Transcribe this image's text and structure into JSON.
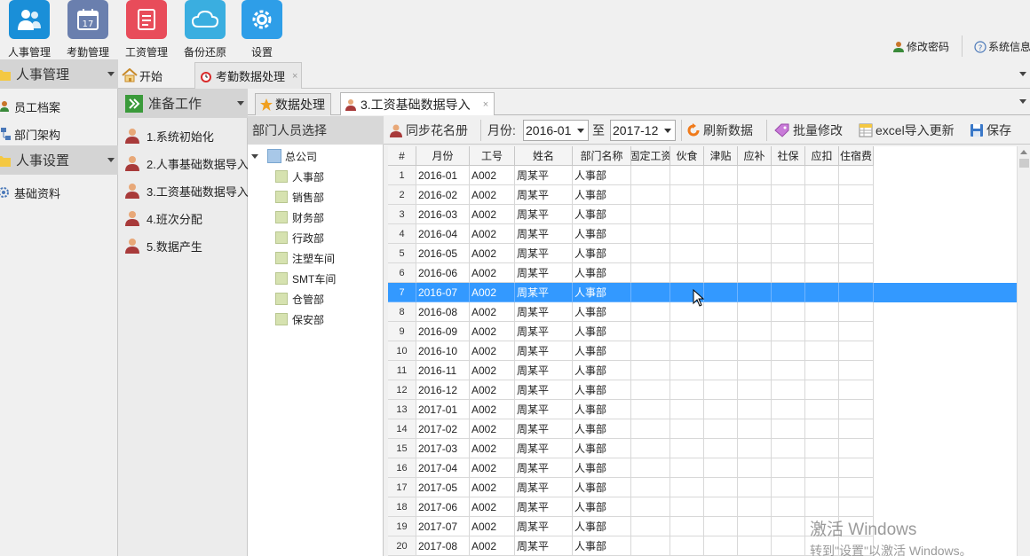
{
  "topbar": {
    "buttons": [
      {
        "label": "人事管理",
        "icon": "people-icon",
        "color": "#1a8fd8"
      },
      {
        "label": "考勤管理",
        "icon": "calendar-icon",
        "color": "#6a7fae"
      },
      {
        "label": "工资管理",
        "icon": "document-icon",
        "color": "#e84c5a"
      },
      {
        "label": "备份还原",
        "icon": "cloud-icon",
        "color": "#3aaee0"
      },
      {
        "label": "设置",
        "icon": "gear-icon",
        "color": "#2e9ee8"
      }
    ],
    "change_password": "修改密码",
    "system_info": "系统信息"
  },
  "leftnav": {
    "section1": "人事管理",
    "items1": [
      "员工档案",
      "部门架构"
    ],
    "section2": "人事设置",
    "items2": [
      "基础资料"
    ]
  },
  "tabs": [
    {
      "label": "开始"
    },
    {
      "label": "考勤数据处理",
      "close": "×"
    }
  ],
  "prep": {
    "title": "准备工作",
    "items": [
      "1.系统初始化",
      "2.人事基础数据导入",
      "3.工资基础数据导入",
      "4.班次分配",
      "5.数据产生"
    ]
  },
  "subtabs": [
    {
      "label": "数据处理"
    },
    {
      "label": "3.工资基础数据导入",
      "close": "×"
    }
  ],
  "dept": {
    "title": "部门人员选择",
    "root": "总公司",
    "items": [
      "人事部",
      "销售部",
      "财务部",
      "行政部",
      "注塑车间",
      "SMT车间",
      "仓管部",
      "保安部"
    ]
  },
  "toolbar": {
    "sync": "同步花名册",
    "month_label": "月份:",
    "from": "2016-01",
    "to_label": "至",
    "to": "2017-12",
    "refresh": "刷新数据",
    "batch": "批量修改",
    "excel": "excel导入更新",
    "save": "保存"
  },
  "grid": {
    "headers": [
      "#",
      "月份",
      "工号",
      "姓名",
      "部门名称",
      "固定工资",
      "伙食",
      "津贴",
      "应补",
      "社保",
      "应扣",
      "住宿费"
    ],
    "selected_row": 7,
    "rows": [
      [
        "1",
        "2016-01",
        "A002",
        "周某平",
        "人事部"
      ],
      [
        "2",
        "2016-02",
        "A002",
        "周某平",
        "人事部"
      ],
      [
        "3",
        "2016-03",
        "A002",
        "周某平",
        "人事部"
      ],
      [
        "4",
        "2016-04",
        "A002",
        "周某平",
        "人事部"
      ],
      [
        "5",
        "2016-05",
        "A002",
        "周某平",
        "人事部"
      ],
      [
        "6",
        "2016-06",
        "A002",
        "周某平",
        "人事部"
      ],
      [
        "7",
        "2016-07",
        "A002",
        "周某平",
        "人事部"
      ],
      [
        "8",
        "2016-08",
        "A002",
        "周某平",
        "人事部"
      ],
      [
        "9",
        "2016-09",
        "A002",
        "周某平",
        "人事部"
      ],
      [
        "10",
        "2016-10",
        "A002",
        "周某平",
        "人事部"
      ],
      [
        "11",
        "2016-11",
        "A002",
        "周某平",
        "人事部"
      ],
      [
        "12",
        "2016-12",
        "A002",
        "周某平",
        "人事部"
      ],
      [
        "13",
        "2017-01",
        "A002",
        "周某平",
        "人事部"
      ],
      [
        "14",
        "2017-02",
        "A002",
        "周某平",
        "人事部"
      ],
      [
        "15",
        "2017-03",
        "A002",
        "周某平",
        "人事部"
      ],
      [
        "16",
        "2017-04",
        "A002",
        "周某平",
        "人事部"
      ],
      [
        "17",
        "2017-05",
        "A002",
        "周某平",
        "人事部"
      ],
      [
        "18",
        "2017-06",
        "A002",
        "周某平",
        "人事部"
      ],
      [
        "19",
        "2017-07",
        "A002",
        "周某平",
        "人事部"
      ],
      [
        "20",
        "2017-08",
        "A002",
        "周某平",
        "人事部"
      ]
    ]
  },
  "watermark": {
    "line1": "激活 Windows",
    "line2": "转到\"设置\"以激活 Windows。"
  }
}
